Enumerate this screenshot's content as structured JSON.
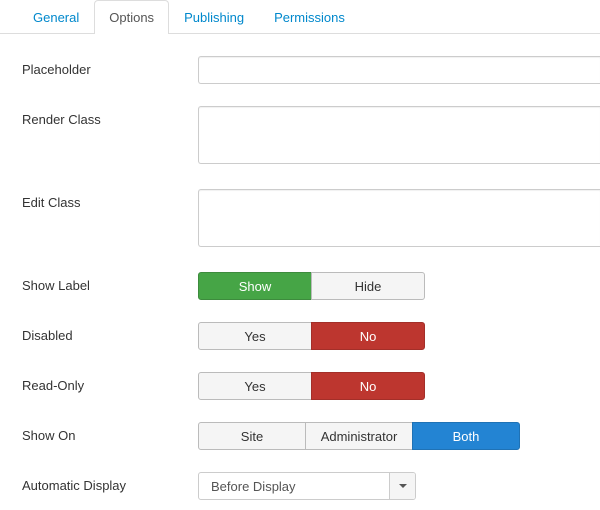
{
  "tabs": {
    "general": "General",
    "options": "Options",
    "publishing": "Publishing",
    "permissions": "Permissions",
    "active": "options"
  },
  "fields": {
    "placeholder": {
      "label": "Placeholder",
      "value": ""
    },
    "render_class": {
      "label": "Render Class",
      "value": ""
    },
    "edit_class": {
      "label": "Edit Class",
      "value": ""
    },
    "show_label": {
      "label": "Show Label",
      "options": {
        "show": "Show",
        "hide": "Hide"
      },
      "selected": "show"
    },
    "disabled": {
      "label": "Disabled",
      "options": {
        "yes": "Yes",
        "no": "No"
      },
      "selected": "no"
    },
    "read_only": {
      "label": "Read-Only",
      "options": {
        "yes": "Yes",
        "no": "No"
      },
      "selected": "no"
    },
    "show_on": {
      "label": "Show On",
      "options": {
        "site": "Site",
        "admin": "Administrator",
        "both": "Both"
      },
      "selected": "both"
    },
    "automatic_display": {
      "label": "Automatic Display",
      "selected": "Before Display"
    }
  }
}
